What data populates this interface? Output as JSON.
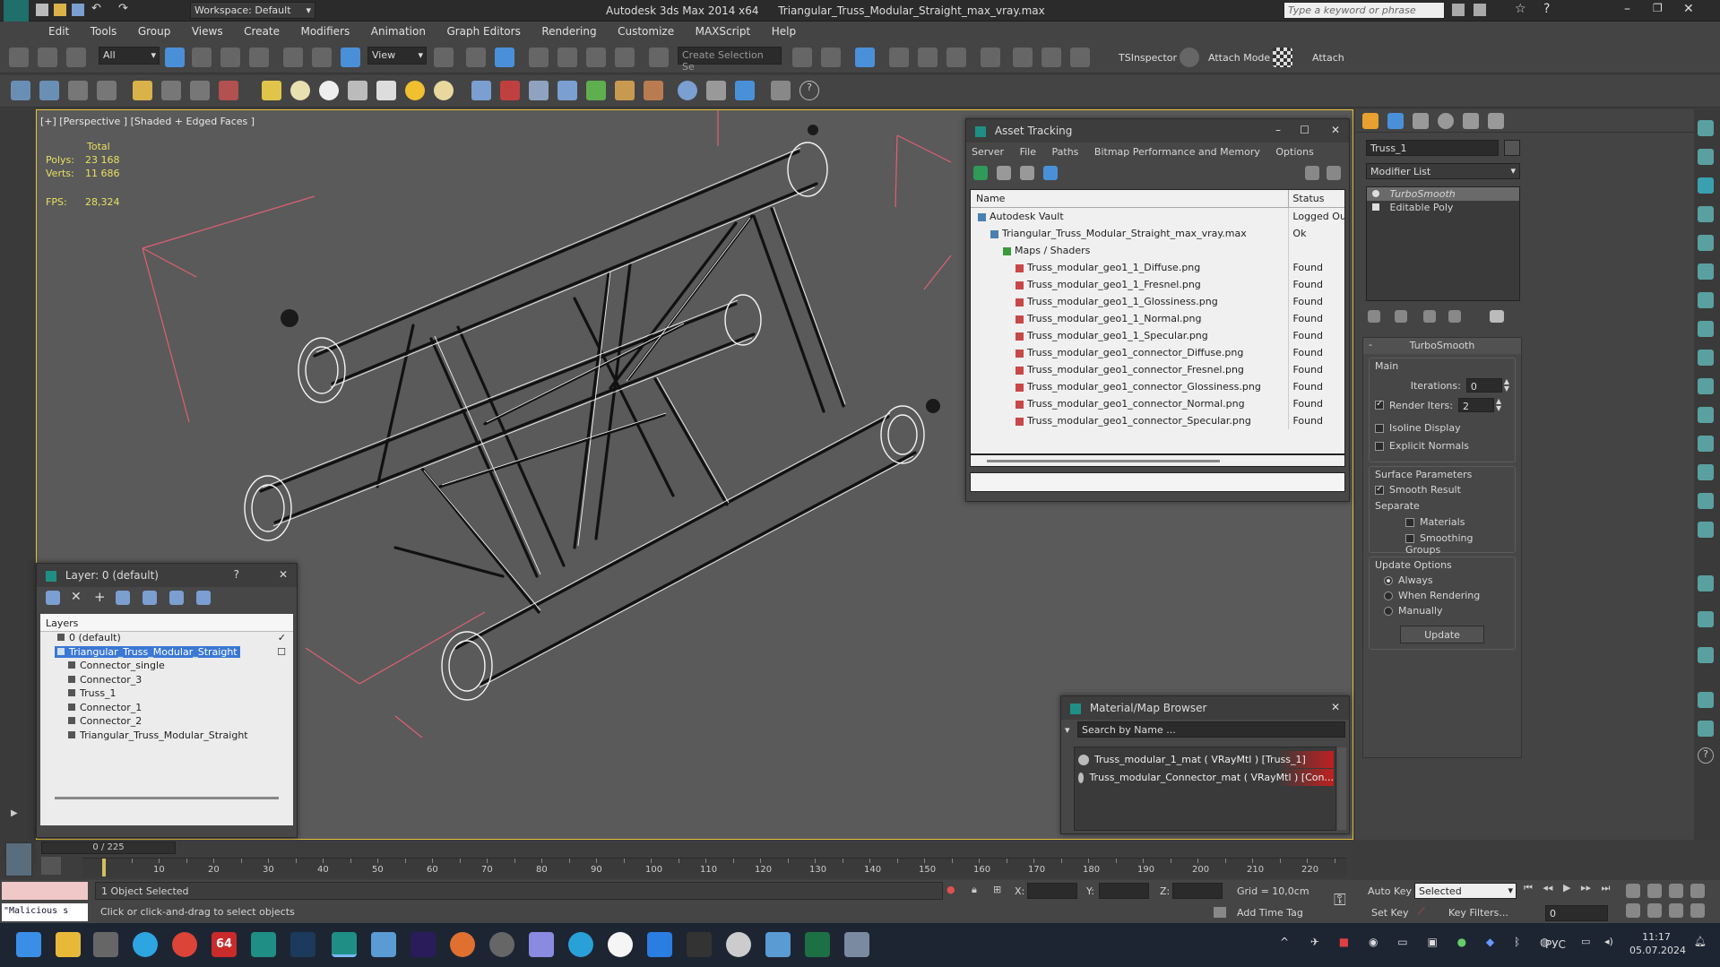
{
  "titlebar": {
    "workspace": "Workspace: Default",
    "app_title": "Autodesk 3ds Max  2014 x64",
    "file_title": "Triangular_Truss_Modular_Straight_max_vray.max",
    "search_placeholder": "Type a keyword or phrase"
  },
  "menu": [
    "Edit",
    "Tools",
    "Group",
    "Views",
    "Create",
    "Modifiers",
    "Animation",
    "Graph Editors",
    "Rendering",
    "Customize",
    "MAXScript",
    "Help"
  ],
  "toolbar": {
    "filter_value": "All",
    "view_value": "View",
    "selection_set_placeholder": "Create Selection Se",
    "tsinspector": "TSInspector",
    "attach_mode": "Attach Mode",
    "attach": "Attach"
  },
  "viewport": {
    "label": "[+] [Perspective ] [Shaded + Edged Faces ]",
    "total_label": "Total",
    "polys_label": "Polys:",
    "polys_value": "23 168",
    "verts_label": "Verts:",
    "verts_value": "11 686",
    "fps_label": "FPS:",
    "fps_value": "28,324"
  },
  "asset_tracking": {
    "title": "Asset Tracking",
    "menu": [
      "Server",
      "File",
      "Paths",
      "Bitmap Performance and Memory",
      "Options"
    ],
    "col_name": "Name",
    "col_status": "Status",
    "rows": [
      {
        "name": "Autodesk Vault",
        "status": "Logged Ou",
        "indent": 0
      },
      {
        "name": "Triangular_Truss_Modular_Straight_max_vray.max",
        "status": "Ok",
        "indent": 1
      },
      {
        "name": "Maps / Shaders",
        "status": "",
        "indent": 2
      },
      {
        "name": "Truss_modular_geo1_1_Diffuse.png",
        "status": "Found",
        "indent": 3
      },
      {
        "name": "Truss_modular_geo1_1_Fresnel.png",
        "status": "Found",
        "indent": 3
      },
      {
        "name": "Truss_modular_geo1_1_Glossiness.png",
        "status": "Found",
        "indent": 3
      },
      {
        "name": "Truss_modular_geo1_1_Normal.png",
        "status": "Found",
        "indent": 3
      },
      {
        "name": "Truss_modular_geo1_1_Specular.png",
        "status": "Found",
        "indent": 3
      },
      {
        "name": "Truss_modular_geo1_connector_Diffuse.png",
        "status": "Found",
        "indent": 3
      },
      {
        "name": "Truss_modular_geo1_connector_Fresnel.png",
        "status": "Found",
        "indent": 3
      },
      {
        "name": "Truss_modular_geo1_connector_Glossiness.png",
        "status": "Found",
        "indent": 3
      },
      {
        "name": "Truss_modular_geo1_connector_Normal.png",
        "status": "Found",
        "indent": 3
      },
      {
        "name": "Truss_modular_geo1_connector_Specular.png",
        "status": "Found",
        "indent": 3
      }
    ]
  },
  "layer_panel": {
    "title": "Layer: 0 (default)",
    "help": "?",
    "header": "Layers",
    "items": [
      {
        "name": "0 (default)",
        "indent": 1,
        "selected": false
      },
      {
        "name": "Triangular_Truss_Modular_Straight",
        "indent": 1,
        "selected": true
      },
      {
        "name": "Connector_single",
        "indent": 2,
        "selected": false
      },
      {
        "name": "Connector_3",
        "indent": 2,
        "selected": false
      },
      {
        "name": "Truss_1",
        "indent": 2,
        "selected": false
      },
      {
        "name": "Connector_1",
        "indent": 2,
        "selected": false
      },
      {
        "name": "Connector_2",
        "indent": 2,
        "selected": false
      },
      {
        "name": "Triangular_Truss_Modular_Straight",
        "indent": 2,
        "selected": false
      }
    ]
  },
  "material_browser": {
    "title": "Material/Map Browser",
    "search_placeholder": "Search by Name ...",
    "items": [
      "Truss_modular_1_mat  ( VRayMtl ) [Truss_1]",
      "Truss_modular_Connector_mat  ( VRayMtl ) [Con..."
    ]
  },
  "command_panel": {
    "object_name": "Truss_1",
    "modifier_list": "Modifier List",
    "stack": [
      "TurboSmooth",
      "Editable Poly"
    ],
    "rollout_title": "TurboSmooth",
    "main_label": "Main",
    "iterations_label": "Iterations:",
    "iterations_value": "0",
    "render_iters_label": "Render Iters:",
    "render_iters_value": "2",
    "isoline_display": "Isoline Display",
    "explicit_normals": "Explicit Normals",
    "surface_params": "Surface Parameters",
    "smooth_result": "Smooth Result",
    "separate": "Separate",
    "materials": "Materials",
    "smoothing_groups": "Smoothing Groups",
    "update_options": "Update Options",
    "always": "Always",
    "when_rendering": "When Rendering",
    "manually": "Manually",
    "update_btn": "Update"
  },
  "timeline": {
    "frame_counter": "0 / 225",
    "ticks": [
      "10",
      "20",
      "30",
      "40",
      "50",
      "60",
      "70",
      "80",
      "90",
      "100",
      "110",
      "120",
      "130",
      "140",
      "150",
      "160",
      "170",
      "180",
      "190",
      "200",
      "210",
      "220"
    ]
  },
  "status": {
    "script_text": "\"Malicious s",
    "selection": "1 Object Selected",
    "prompt": "Click or click-and-drag to select objects",
    "x_label": "X:",
    "y_label": "Y:",
    "z_label": "Z:",
    "grid": "Grid = 10,0cm",
    "add_time_tag": "Add Time Tag",
    "auto_key": "Auto Key",
    "selected": "Selected",
    "set_key": "Set Key",
    "key_filters": "Key Filters...",
    "frame_value": "0"
  },
  "taskbar": {
    "lang": "РУС",
    "time": "11:17",
    "date": "05.07.2024",
    "badge": "64"
  }
}
